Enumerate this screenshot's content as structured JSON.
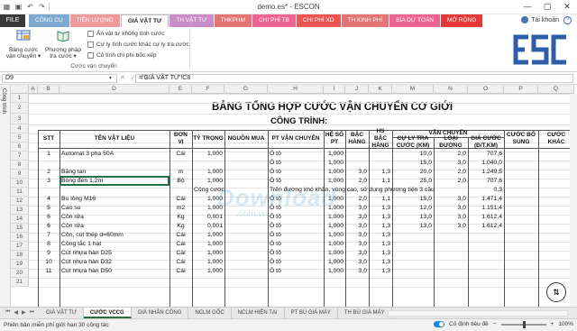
{
  "window": {
    "title": "demo.es* - ESCON",
    "controls": [
      "—",
      "▢",
      "✕"
    ]
  },
  "ribbon": {
    "file_tab": "FILE",
    "tabs": [
      {
        "label": "CÔNG CỤ",
        "color": "#7fa8d0"
      },
      {
        "label": "TIẾN LƯỢNG",
        "color": "#ef9a9a"
      },
      {
        "label": "GIÁ VẬT TƯ",
        "color": "#ffffff",
        "active": true
      },
      {
        "label": "TH VẬT TƯ",
        "color": "#c98ec9"
      },
      {
        "label": "THKPHM",
        "color": "#e57373"
      },
      {
        "label": "CHI PHÍ TB",
        "color": "#f06292"
      },
      {
        "label": "CHI PHÍ XD",
        "color": "#ef5350"
      },
      {
        "label": "TH KINH PHÍ",
        "color": "#e57373"
      },
      {
        "label": "BÌA DỰ TOÁN",
        "color": "#f06292"
      },
      {
        "label": "MỞ RỘNG",
        "color": "#e53935"
      }
    ],
    "account": "Tài khoản",
    "buttons": [
      {
        "label1": "Bảng cước",
        "label2": "vận chuyển ▾"
      },
      {
        "label1": "Phương pháp",
        "label2": "tra cước ▾"
      }
    ],
    "checkboxes": [
      "Ẩn vật tư không tính cước",
      "Cự ly tính cước khác cự ly tra cước",
      "Có tính chi phí bốc xếp"
    ],
    "group_label": "Cước vận chuyển"
  },
  "formula_bar": {
    "name_box": "D9",
    "fx": "✕ ✓ fx",
    "formula": "='GIÁ VẬT TƯ'!C8"
  },
  "sidebar_label": "Công trình",
  "columns": [
    "A",
    "B",
    "D",
    "E",
    "F",
    "G",
    "H",
    "I",
    "J",
    "K",
    "M",
    "N",
    "O",
    "P",
    "Q"
  ],
  "rows": [
    "1",
    "2",
    "3",
    "4",
    "5",
    "6",
    "7",
    "8",
    "9",
    "10",
    "11",
    "12",
    "13",
    "14",
    "15",
    "16",
    "17",
    "18",
    "19",
    "20",
    "21"
  ],
  "sheet": {
    "title": "BẢNG TỔNG HỢP CƯỚC VẬN CHUYỂN CƠ GIỚI",
    "subtitle": "CÔNG TRÌNH:",
    "headers": {
      "stt": "STT",
      "ten": "TÊN VẬT LIỆU",
      "dv1": "ĐƠN",
      "dv2": "VỊ",
      "ty": "TỶ TRỌNG",
      "nguon": "NGUỒN MUA",
      "pt": "PT VẬN CHUYỂN",
      "hs1": "HỆ SỐ",
      "hs2": "PT",
      "bac1": "BẬC",
      "bac2": "HÀNG",
      "hsb1": "HS",
      "hsb2": "BẬC",
      "hsb3": "HÀNG",
      "vc": "VẬN CHUYỂN",
      "cly1": "CỰ LY TRA",
      "cly2": "CƯỚC (KM)",
      "loai1": "LOẠI",
      "loai2": "ĐƯỜNG",
      "gc1": "GIÁ CƯỚC",
      "gc2": "(Đ/T.KM)",
      "cbs1": "CƯỚC BỔ",
      "cbs2": "SUNG",
      "ck1": "CƯỚC",
      "ck2": "KHÁC"
    },
    "data_rows": [
      {
        "stt": "1",
        "ten": "Automat 3 pha 50A",
        "dv": "Cái",
        "ty": "1,000",
        "pt": "Ô tô",
        "hs": "1,000",
        "bac": "",
        "hsb": "",
        "cly": "10,0",
        "loai": "2,0",
        "gc": "707,6"
      },
      {
        "stt": "",
        "ten": "",
        "dv": "",
        "ty": "",
        "pt": "Ô tô",
        "hs": "1,000",
        "bac": "",
        "hsb": "",
        "cly": "15,0",
        "loai": "3,0",
        "gc": "1.040,0"
      },
      {
        "stt": "2",
        "ten": "Băng tan",
        "dv": "m",
        "ty": "1,000",
        "pt": "Ô tô",
        "hs": "1,000",
        "bac": "3,0",
        "hsb": "1,3",
        "cly": "20,0",
        "loai": "2,0",
        "gc": "1.249,5"
      },
      {
        "stt": "3",
        "ten": "Bóng đèn 1,2m",
        "dv": "Bộ",
        "ty": "1,000",
        "pt": "Ô tô",
        "hs": "1,000",
        "bac": "2,0",
        "hsb": "1,1",
        "cly": "25,0",
        "loai": "2,0",
        "gc": "707,6"
      },
      {
        "stt": "",
        "ten": "",
        "dv": "",
        "ty": "Công cước",
        "pt": "Trên đường khó khăn, vùng cao, sử dụng phương tiện 3 cầu",
        "hs": "",
        "bac": "",
        "hsb": "",
        "cly": "",
        "loai": "",
        "gc": "0,3"
      },
      {
        "stt": "4",
        "ten": "Bu lông M16",
        "dv": "Cái",
        "ty": "1,000",
        "pt": "Ô tô",
        "hs": "1,000",
        "bac": "2,0",
        "hsb": "1,1",
        "cly": "15,0",
        "loai": "3,0",
        "gc": "1.471,4"
      },
      {
        "stt": "5",
        "ten": "Cao su",
        "dv": "m2",
        "ty": "1,000",
        "pt": "Ô tô",
        "hs": "1,000",
        "bac": "3,0",
        "hsb": "1,3",
        "cly": "12,0",
        "loai": "3,0",
        "gc": "1.151,4"
      },
      {
        "stt": "6",
        "ten": "Côn rửa",
        "dv": "Kg",
        "ty": "0,001",
        "pt": "Ô tô",
        "hs": "1,000",
        "bac": "3,0",
        "hsb": "1,3",
        "cly": "13,0",
        "loai": "3,0",
        "gc": "1.612,4"
      },
      {
        "stt": "6",
        "ten": "Côn rửa",
        "dv": "Kg",
        "ty": "0,001",
        "pt": "Ô tô",
        "hs": "1,000",
        "bac": "3,0",
        "hsb": "1,3",
        "cly": "13,0",
        "loai": "3,0",
        "gc": "1.612,4"
      },
      {
        "stt": "7",
        "ten": "Côn, cút thép d=60mm",
        "dv": "Cái",
        "ty": "1,000",
        "pt": "Ô tô",
        "hs": "1,000",
        "bac": "3,0",
        "hsb": "1,3",
        "cly": "",
        "loai": "",
        "gc": ""
      },
      {
        "stt": "8",
        "ten": "Công tắc 1 hạt",
        "dv": "Cái",
        "ty": "1,000",
        "pt": "Ô tô",
        "hs": "1,000",
        "bac": "3,0",
        "hsb": "1,3",
        "cly": "",
        "loai": "",
        "gc": ""
      },
      {
        "stt": "9",
        "ten": "Cút nhựa hàn D25",
        "dv": "Cái",
        "ty": "1,000",
        "pt": "Ô tô",
        "hs": "1,000",
        "bac": "3,0",
        "hsb": "1,3",
        "cly": "",
        "loai": "",
        "gc": ""
      },
      {
        "stt": "10",
        "ten": "Cút nhựa hàn D32",
        "dv": "Cái",
        "ty": "1,000",
        "pt": "Ô tô",
        "hs": "1,000",
        "bac": "3,0",
        "hsb": "1,3",
        "cly": "",
        "loai": "",
        "gc": ""
      },
      {
        "stt": "11",
        "ten": "Cút nhựa hàn D50",
        "dv": "Cái",
        "ty": "1,000",
        "pt": "Ô tô",
        "hs": "1,000",
        "bac": "3,0",
        "hsb": "1,3",
        "cly": "",
        "loai": "",
        "gc": ""
      }
    ]
  },
  "sheet_tabs": [
    "GIÁ VẬT TƯ",
    "CƯỚC VCCG",
    "GIÁ NHÂN CÔNG",
    "NCLM GỐC",
    "NCLM HIỆN TẠI",
    "PT BÙ GIÁ MÁY",
    "TH BÙ GIÁ MÁY"
  ],
  "active_sheet_tab": 1,
  "statusbar": {
    "left": "Phiên bản miễn phí giới hạn 30 công tác",
    "mode": "Cố định tiêu đề",
    "zoom": "100%"
  },
  "watermark": {
    "main": "Download",
    "sub": ".com.vn"
  },
  "colors": {
    "accent": "#217346",
    "logo_blue": "#2f5da8"
  }
}
